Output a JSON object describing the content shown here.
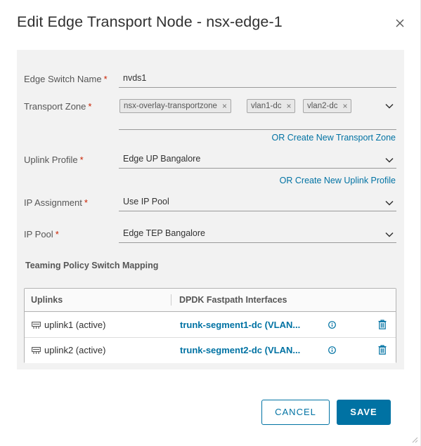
{
  "dialog": {
    "title": "Edit Edge Transport Node - nsx-edge-1"
  },
  "form": {
    "edge_switch_name": {
      "label": "Edge Switch Name",
      "value": "nvds1"
    },
    "transport_zone": {
      "label": "Transport Zone",
      "tags": [
        "nsx-overlay-transportzone",
        "vlan1-dc",
        "vlan2-dc"
      ],
      "create_link": "OR Create New Transport Zone"
    },
    "uplink_profile": {
      "label": "Uplink Profile",
      "value": "Edge UP Bangalore",
      "create_link": "OR Create New Uplink Profile"
    },
    "ip_assignment": {
      "label": "IP Assignment",
      "value": "Use IP Pool"
    },
    "ip_pool": {
      "label": "IP Pool",
      "value": "Edge TEP Bangalore"
    },
    "required_marker": "*"
  },
  "teaming": {
    "section_title": "Teaming Policy Switch Mapping",
    "columns": [
      "Uplinks",
      "DPDK Fastpath Interfaces"
    ],
    "rows": [
      {
        "uplink": "uplink1 (active)",
        "interface": "trunk-segment1-dc (VLAN..."
      },
      {
        "uplink": "uplink2 (active)",
        "interface": "trunk-segment2-dc (VLAN..."
      }
    ]
  },
  "footer": {
    "cancel_label": "CANCEL",
    "save_label": "SAVE"
  },
  "colors": {
    "accent": "#0072a3",
    "required": "#c92100",
    "panel_bg": "#f2f2f2"
  },
  "icons": {
    "close": "close-icon",
    "caret": "chevron-down-icon",
    "uplink": "uplink-icon",
    "info": "info-icon",
    "delete": "trash-icon"
  }
}
